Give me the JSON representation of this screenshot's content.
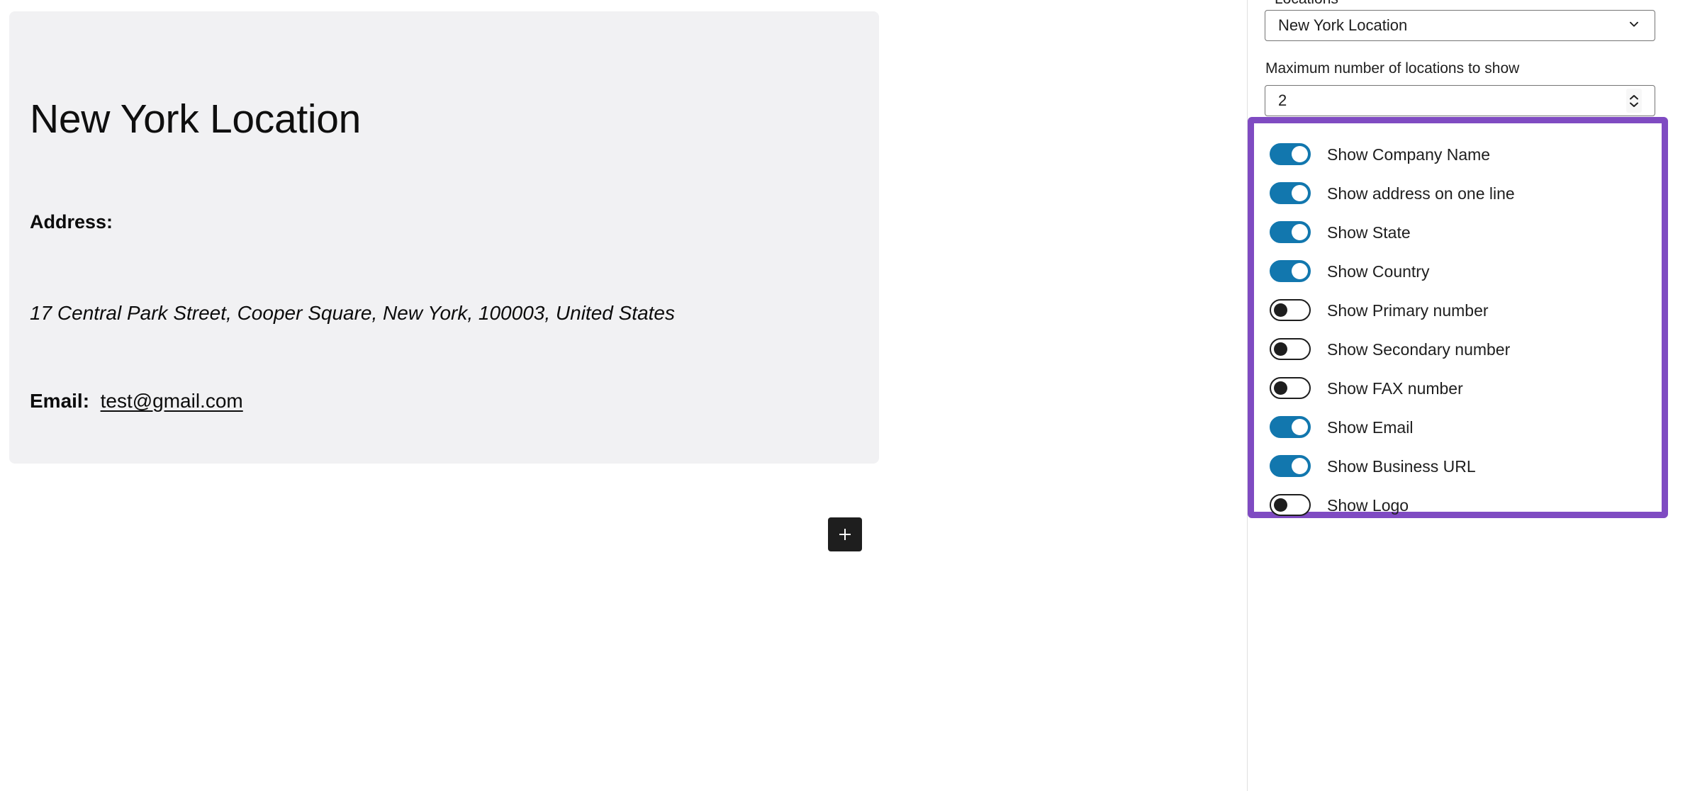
{
  "editor": {
    "card": {
      "title": "New York Location",
      "address_label": "Address:",
      "address_value": "17 Central Park Street, Cooper Square, New York, 100003, United States",
      "email_label": "Email:",
      "email_value": "test@gmail.com"
    },
    "add_block_button": {
      "name": "add-block",
      "icon": "plus-icon"
    }
  },
  "sidebar": {
    "locations_label": "Locations",
    "locations_select": {
      "value": "New York Location",
      "icon": "chevron-down-icon"
    },
    "max_locations_label": "Maximum number of locations to show",
    "max_locations_value": "2",
    "spinner": {
      "up_icon": "chevron-up-icon",
      "down_icon": "chevron-down-icon"
    },
    "toggles": [
      {
        "label": "Show Company Name",
        "state": "on"
      },
      {
        "label": "Show address on one line",
        "state": "on"
      },
      {
        "label": "Show State",
        "state": "on"
      },
      {
        "label": "Show Country",
        "state": "on"
      },
      {
        "label": "Show Primary number",
        "state": "off"
      },
      {
        "label": "Show Secondary number",
        "state": "off"
      },
      {
        "label": "Show FAX number",
        "state": "off"
      },
      {
        "label": "Show Email",
        "state": "on"
      },
      {
        "label": "Show Business URL",
        "state": "on"
      },
      {
        "label": "Show Logo",
        "state": "off"
      }
    ]
  },
  "colors": {
    "highlight_purple": "#7f4bc2",
    "toggle_on_blue": "#1277ae",
    "card_background": "#f1f1f3",
    "add_block_dark": "#1e1e1e",
    "border_gray": "#757575"
  }
}
